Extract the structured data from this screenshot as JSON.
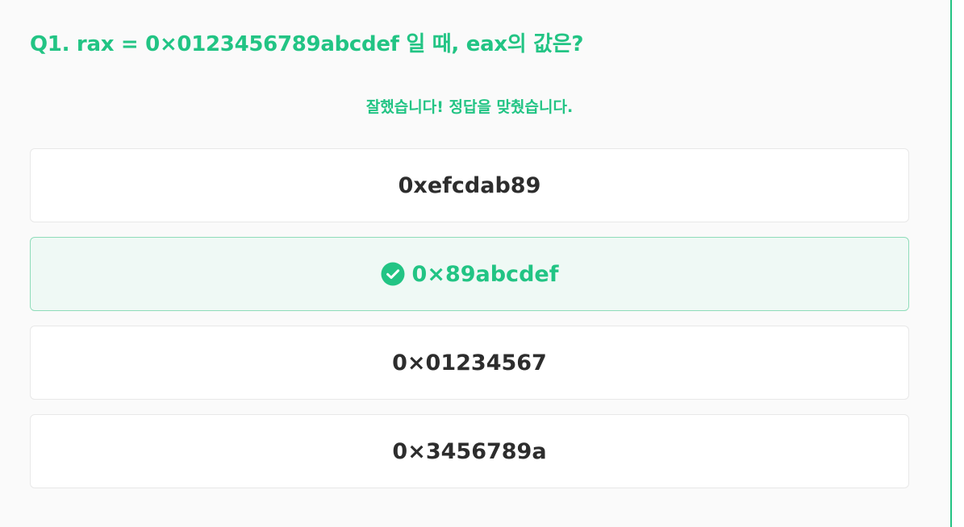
{
  "quiz": {
    "question": "Q1. rax = 0×0123456789abcdef 일 때, eax의 값은?",
    "feedback": "잘했습니다! 정답을 맞췄습니다.",
    "options": [
      {
        "label": "0xefcdab89",
        "correct": false
      },
      {
        "label": "0×89abcdef",
        "correct": true,
        "icon": "check-circle-icon"
      },
      {
        "label": "0×01234567",
        "correct": false
      },
      {
        "label": "0×3456789a",
        "correct": false
      }
    ]
  },
  "colors": {
    "accent": "#22c484",
    "correct_bg": "#eff9f5",
    "correct_border": "#8fdcba",
    "text": "#2d2d2d"
  }
}
